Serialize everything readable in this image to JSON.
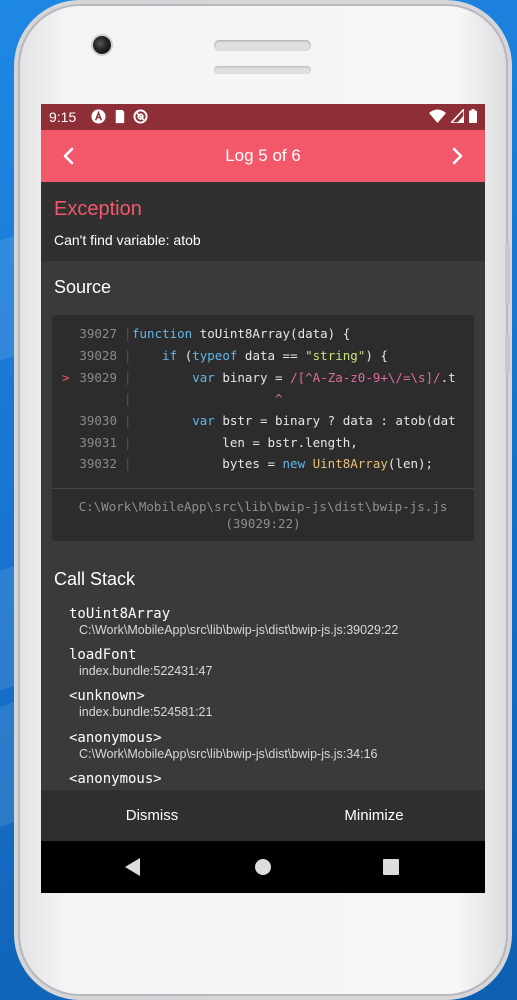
{
  "status_bar": {
    "time": "9:15",
    "left_icons": [
      "a-circle-icon",
      "sd-card-icon",
      "no-sync-icon"
    ],
    "right_icons": [
      "wifi-icon",
      "signal-icon",
      "battery-icon"
    ]
  },
  "app_bar": {
    "title": "Log 5 of 6",
    "prev_icon": "chevron-left-icon",
    "next_icon": "chevron-right-icon"
  },
  "exception": {
    "title": "Exception",
    "message": "Can't find variable: atob"
  },
  "source": {
    "title": "Source",
    "lines": [
      {
        "num": "39027",
        "marker": "",
        "code_html": "function toUint8Array(data) {"
      },
      {
        "num": "39028",
        "marker": "",
        "code_html": "    if (typeof data == \"string\") {"
      },
      {
        "num": "39029",
        "marker": ">",
        "code_html": "        var binary = /[^A-Za-z0-9+\\/=\\s]/.t"
      },
      {
        "num": "",
        "marker": "",
        "code_html": "                   ^"
      },
      {
        "num": "39030",
        "marker": "",
        "code_html": "        var bstr = binary ? data : atob(dat"
      },
      {
        "num": "39031",
        "marker": "",
        "code_html": "            len = bstr.length,"
      },
      {
        "num": "39032",
        "marker": "",
        "code_html": "            bytes = new Uint8Array(len);"
      }
    ],
    "file": "C:\\Work\\MobileApp\\src\\lib\\bwip-js\\dist\\bwip-js.js",
    "position": "(39029:22)"
  },
  "call_stack": {
    "title": "Call Stack",
    "frames": [
      {
        "fn": "toUint8Array",
        "loc": "C:\\Work\\MobileApp\\src\\lib\\bwip-js\\dist\\bwip-js.js:39029:22"
      },
      {
        "fn": "loadFont",
        "loc": "index.bundle:522431:47"
      },
      {
        "fn": "<unknown>",
        "loc": "index.bundle:524581:21"
      },
      {
        "fn": "<anonymous>",
        "loc": "C:\\Work\\MobileApp\\src\\lib\\bwip-js\\dist\\bwip-js.js:34:16"
      },
      {
        "fn": "<anonymous>",
        "loc": ""
      }
    ]
  },
  "buttons": {
    "dismiss": "Dismiss",
    "minimize": "Minimize"
  },
  "nav_bar": {
    "back_icon": "triangle-back-icon",
    "home_icon": "circle-home-icon",
    "recents_icon": "square-recents-icon"
  },
  "colors": {
    "accent": "#f2576a",
    "status_bar": "#8e2f37",
    "background": "#3a3a3a"
  }
}
